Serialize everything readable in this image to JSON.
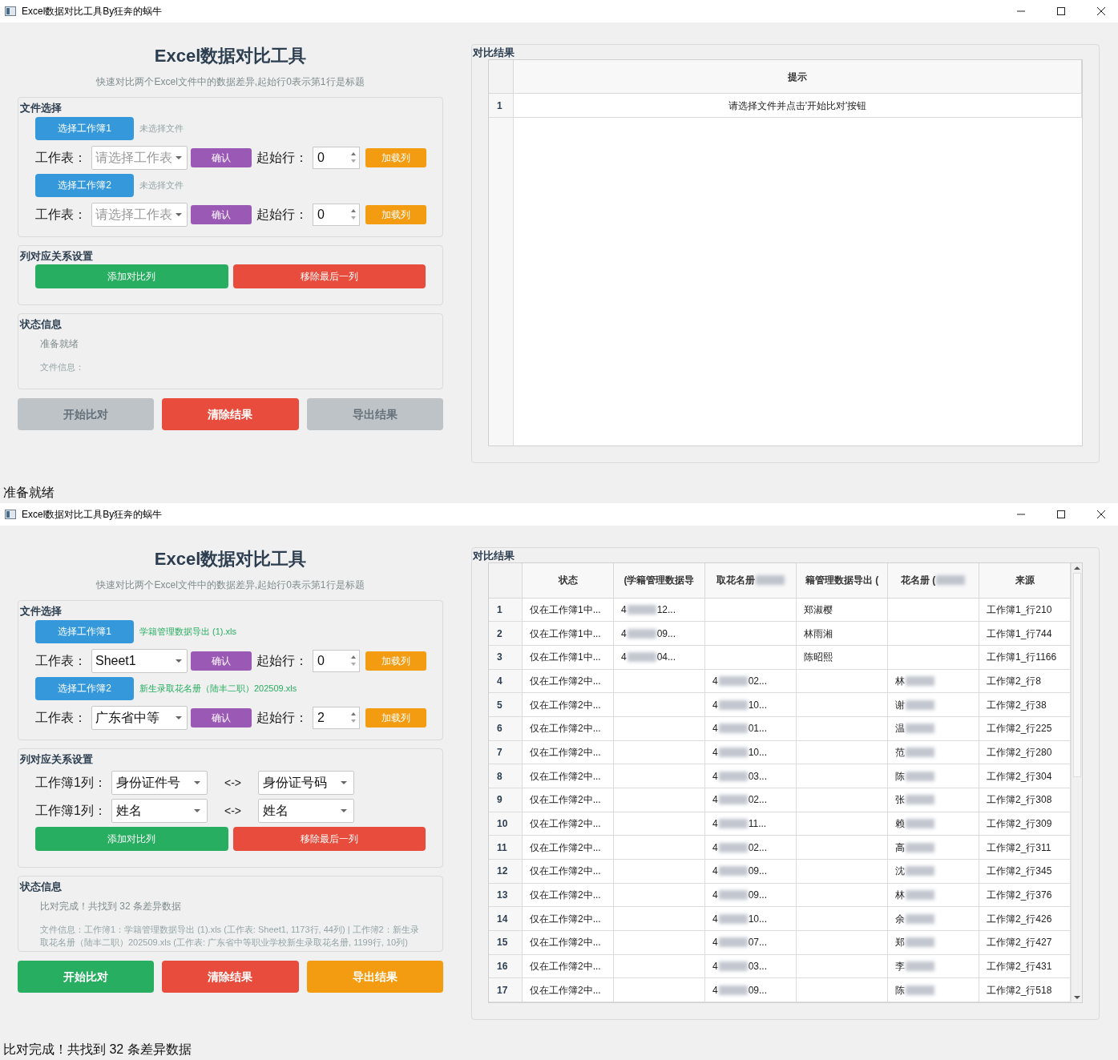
{
  "windows": [
    {
      "title": "Excel数据对比工具By狂奔的蜗牛",
      "heading": "Excel数据对比工具",
      "subtitle": "快速对比两个Excel文件中的数据差异,起始行0表示第1行是标题",
      "file_section": {
        "title": "文件选择",
        "workbooks": [
          {
            "button": "选择工作簿1",
            "file": "未选择文件",
            "file_chosen": false,
            "sheet_label": "工作表：",
            "sheet": {
              "placeholder": "请选择工作表"
            },
            "confirm": "确认",
            "start_label": "起始行：",
            "start_row": "0",
            "load": "加载列"
          },
          {
            "button": "选择工作簿2",
            "file": "未选择文件",
            "file_chosen": false,
            "sheet_label": "工作表：",
            "sheet": {
              "placeholder": "请选择工作表"
            },
            "confirm": "确认",
            "start_label": "起始行：",
            "start_row": "0",
            "load": "加载列"
          }
        ]
      },
      "mapping": {
        "title": "列对应关系设置",
        "add": "添加对比列",
        "remove": "移除最后一列"
      },
      "status": {
        "title": "状态信息",
        "message": "准备就绪",
        "file_info": "文件信息："
      },
      "actions": [
        {
          "kind": "start",
          "label": "开始比对",
          "enabled": false
        },
        {
          "kind": "clear",
          "label": "清除结果",
          "enabled": true
        },
        {
          "kind": "export",
          "label": "导出结果",
          "enabled": false
        }
      ],
      "results": {
        "title": "对比结果",
        "columns": [
          "提示"
        ],
        "rows": [
          {
            "number": "1",
            "cells": [
              "请选择文件并点击'开始比对'按钮"
            ]
          }
        ]
      },
      "status_bar": "准备就绪"
    },
    {
      "title": "Excel数据对比工具By狂奔的蜗牛",
      "heading": "Excel数据对比工具",
      "subtitle": "快速对比两个Excel文件中的数据差异,起始行0表示第1行是标题",
      "file_section": {
        "title": "文件选择",
        "workbooks": [
          {
            "button": "选择工作簿1",
            "file": "学籍管理数据导出 (1).xls",
            "file_chosen": true,
            "sheet_label": "工作表：",
            "sheet": {
              "value": "Sheet1"
            },
            "confirm": "确认",
            "start_label": "起始行：",
            "start_row": "0",
            "load": "加载列"
          },
          {
            "button": "选择工作簿2",
            "file": "新生录取花名册（陆丰二职）202509.xls",
            "file_chosen": true,
            "sheet_label": "工作表：",
            "sheet": {
              "value": "广东省中等"
            },
            "confirm": "确认",
            "start_label": "起始行：",
            "start_row": "2",
            "load": "加载列"
          }
        ]
      },
      "mapping": {
        "title": "列对应关系设置",
        "pairs": [
          {
            "label": "工作簿1列：",
            "left": "身份证件号",
            "arrow": "<->",
            "right": "身份证号码"
          },
          {
            "label": "工作簿1列：",
            "left": "姓名",
            "arrow": "<->",
            "right": "姓名"
          }
        ],
        "add": "添加对比列",
        "remove": "移除最后一列"
      },
      "status": {
        "title": "状态信息",
        "message": "比对完成！共找到 32 条差异数据",
        "file_info": "文件信息：工作簿1：学籍管理数据导出 (1).xls (工作表: Sheet1, 1173行, 44列) | 工作簿2：新生录取花名册（陆丰二职）202509.xls (工作表: 广东省中等职业学校新生录取花名册, 1199行, 10列)"
      },
      "actions": [
        {
          "kind": "start",
          "label": "开始比对",
          "enabled": true
        },
        {
          "kind": "clear",
          "label": "清除结果",
          "enabled": true
        },
        {
          "kind": "export",
          "label": "导出结果",
          "enabled": true
        }
      ],
      "results": {
        "title": "对比结果",
        "columns": [
          "状态",
          "(学籍管理数据导",
          {
            "head": "取花名册"
          },
          "籍管理数据导出 (",
          {
            "head": "花名册 ("
          },
          "来源"
        ],
        "rows": [
          {
            "number": "1",
            "cells": [
              "仅在工作簿1中...",
              {
                "head": "4",
                "tail": "12..."
              },
              null,
              "郑淑樱",
              null,
              "工作簿1_行210"
            ]
          },
          {
            "number": "2",
            "cells": [
              "仅在工作簿1中...",
              {
                "head": "4",
                "tail": "09..."
              },
              null,
              "林雨湘",
              null,
              "工作簿1_行744"
            ]
          },
          {
            "number": "3",
            "cells": [
              "仅在工作簿1中...",
              {
                "head": "4",
                "tail": "04..."
              },
              null,
              "陈昭熙",
              null,
              "工作簿1_行1166"
            ]
          },
          {
            "number": "4",
            "cells": [
              "仅在工作簿2中...",
              null,
              {
                "head": "4",
                "tail": "02..."
              },
              null,
              {
                "head": "林"
              },
              "工作簿2_行8"
            ]
          },
          {
            "number": "5",
            "cells": [
              "仅在工作簿2中...",
              null,
              {
                "head": "4",
                "tail": "10..."
              },
              null,
              {
                "head": "谢"
              },
              "工作簿2_行38"
            ]
          },
          {
            "number": "6",
            "cells": [
              "仅在工作簿2中...",
              null,
              {
                "head": "4",
                "tail": "01..."
              },
              null,
              {
                "head": "温"
              },
              "工作簿2_行225"
            ]
          },
          {
            "number": "7",
            "cells": [
              "仅在工作簿2中...",
              null,
              {
                "head": "4",
                "tail": "10..."
              },
              null,
              {
                "head": "范"
              },
              "工作簿2_行280"
            ]
          },
          {
            "number": "8",
            "cells": [
              "仅在工作簿2中...",
              null,
              {
                "head": "4",
                "tail": "03..."
              },
              null,
              {
                "head": "陈"
              },
              "工作簿2_行304"
            ]
          },
          {
            "number": "9",
            "cells": [
              "仅在工作簿2中...",
              null,
              {
                "head": "4",
                "tail": "02..."
              },
              null,
              {
                "head": "张"
              },
              "工作簿2_行308"
            ]
          },
          {
            "number": "10",
            "cells": [
              "仅在工作簿2中...",
              null,
              {
                "head": "4",
                "tail": "11..."
              },
              null,
              {
                "head": "赖"
              },
              "工作簿2_行309"
            ]
          },
          {
            "number": "11",
            "cells": [
              "仅在工作簿2中...",
              null,
              {
                "head": "4",
                "tail": "02..."
              },
              null,
              {
                "head": "高"
              },
              "工作簿2_行311"
            ]
          },
          {
            "number": "12",
            "cells": [
              "仅在工作簿2中...",
              null,
              {
                "head": "4",
                "tail": "09..."
              },
              null,
              {
                "head": "沈"
              },
              "工作簿2_行345"
            ]
          },
          {
            "number": "13",
            "cells": [
              "仅在工作簿2中...",
              null,
              {
                "head": "4",
                "tail": "09..."
              },
              null,
              {
                "head": "林"
              },
              "工作簿2_行376"
            ]
          },
          {
            "number": "14",
            "cells": [
              "仅在工作簿2中...",
              null,
              {
                "head": "4",
                "tail": "10..."
              },
              null,
              {
                "head": "余"
              },
              "工作簿2_行426"
            ]
          },
          {
            "number": "15",
            "cells": [
              "仅在工作簿2中...",
              null,
              {
                "head": "4",
                "tail": "07..."
              },
              null,
              {
                "head": "郑"
              },
              "工作簿2_行427"
            ]
          },
          {
            "number": "16",
            "cells": [
              "仅在工作簿2中...",
              null,
              {
                "head": "4",
                "tail": "03..."
              },
              null,
              {
                "head": "李"
              },
              "工作簿2_行431"
            ]
          },
          {
            "number": "17",
            "cells": [
              "仅在工作簿2中...",
              null,
              {
                "head": "4",
                "tail": "09..."
              },
              null,
              {
                "head": "陈"
              },
              "工作簿2_行518"
            ]
          }
        ],
        "scrollable": true
      },
      "status_bar": "比对完成！共找到 32 条差异数据"
    }
  ]
}
